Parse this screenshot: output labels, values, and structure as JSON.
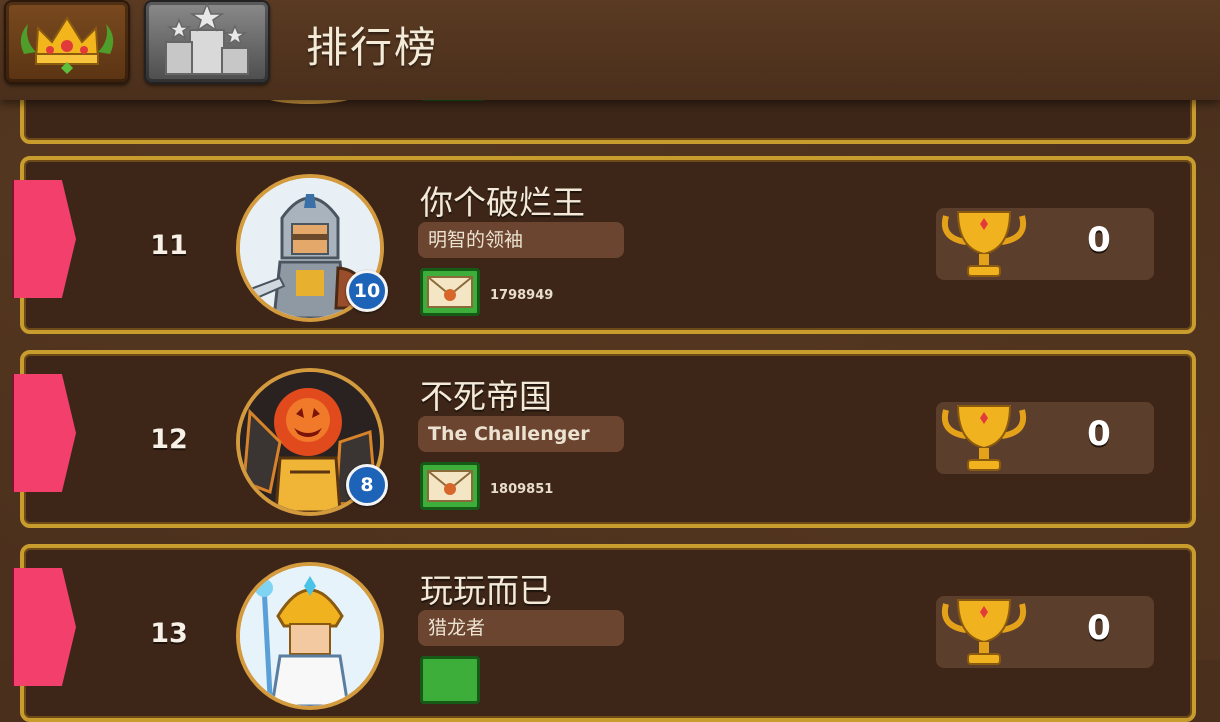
{
  "header": {
    "title": "排行榜",
    "tabs": [
      {
        "icon": "crown-laurel-icon",
        "active": true
      },
      {
        "icon": "podium-stars-icon",
        "active": false
      }
    ]
  },
  "rows": [
    {
      "rank": "11",
      "name": "你个破烂王",
      "title": "明智的领袖",
      "level": "10",
      "player_id": "1798949",
      "score": "0",
      "avatar": "knight-avatar"
    },
    {
      "rank": "12",
      "name": "不死帝国",
      "title": "The Challenger",
      "level": "8",
      "player_id": "1809851",
      "score": "0",
      "avatar": "pumpkin-golem-avatar"
    },
    {
      "rank": "13",
      "name": "玩玩而已",
      "title": "猎龙者",
      "score": "0",
      "avatar": "golden-warrior-avatar"
    }
  ],
  "colors": {
    "ribbon": "#f23f6c",
    "row_border": "#c99d2d",
    "level_badge": "#1d63b8",
    "mail_button": "#3eae3a"
  }
}
